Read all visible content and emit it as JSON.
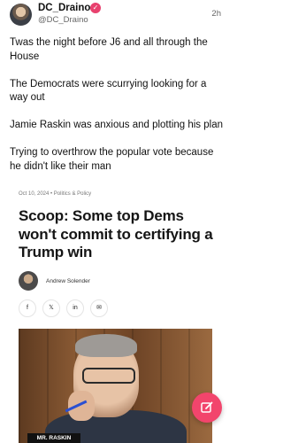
{
  "post": {
    "display_name": "DC_Draino",
    "verified_icon": "verified-badge-icon",
    "handle": "@DC_Draino",
    "timestamp": "2h",
    "paragraphs": [
      "Twas the night before J6 and all through the House",
      "The Democrats were scurrying looking for a way out",
      "Jamie Raskin was anxious and plotting his plan",
      "Trying to overthrow the popular vote because he didn't like their man"
    ]
  },
  "article": {
    "meta": "Oct 10, 2024 • Politics & Policy",
    "headline": "Scoop: Some top Dems won't commit to certifying a Trump win",
    "author": "Andrew Solender",
    "share": [
      "f",
      "𝕏",
      "in",
      "✉"
    ],
    "photo_nameplate": "MR. RASKIN"
  },
  "compose_button": {
    "icon": "compose-icon"
  },
  "colors": {
    "accent": "#f2456c",
    "badge": "#e8416e"
  }
}
